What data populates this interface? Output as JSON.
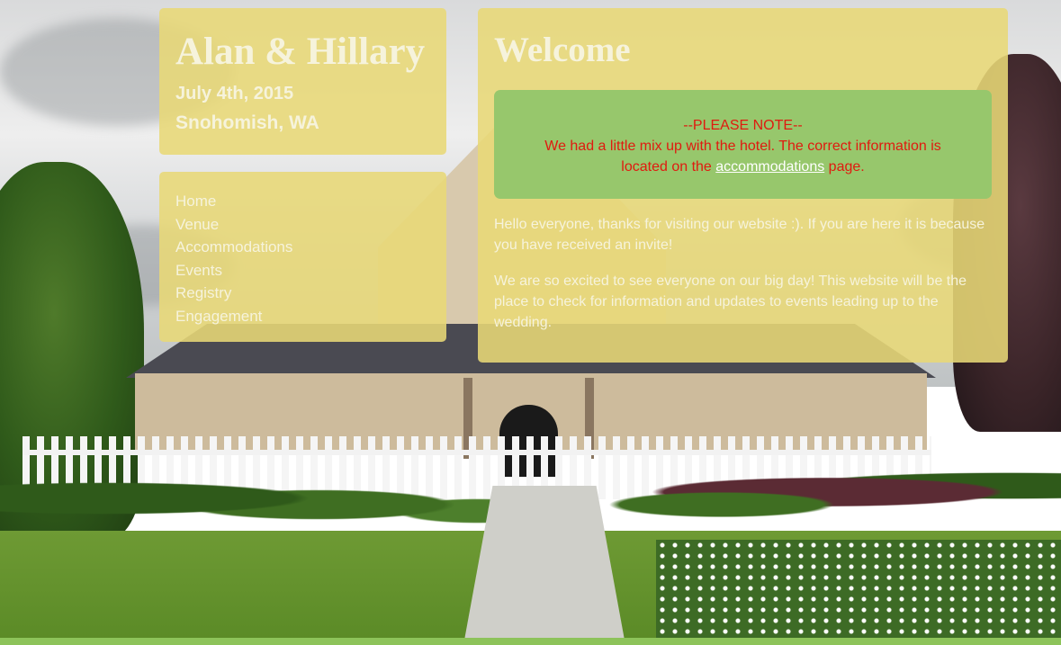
{
  "header": {
    "names": "Alan & Hillary",
    "date": "July 4th, 2015",
    "location": "Snohomish, WA"
  },
  "nav": {
    "items": [
      {
        "label": "Home"
      },
      {
        "label": "Venue"
      },
      {
        "label": "Accommodations"
      },
      {
        "label": "Events"
      },
      {
        "label": "Registry"
      },
      {
        "label": "Engagement"
      }
    ]
  },
  "main": {
    "heading": "Welcome",
    "notice": {
      "head": "--PLEASE NOTE--",
      "text_before": "We had a little mix up with the hotel. The correct information is located on the ",
      "link": "accommodations",
      "text_after": " page."
    },
    "paragraphs": [
      "Hello everyone, thanks for visiting our website :). If you are here it is because you have received an invite!",
      "We are so excited to see everyone on our big day! This website will be the place to check for information and updates to events leading up to the wedding."
    ]
  },
  "colors": {
    "panel": "#e8d876",
    "notice_bg": "#97c76c",
    "notice_text": "#e01a0f",
    "panel_text": "#f6f3dc",
    "footer_bar": "#8dc35a"
  }
}
